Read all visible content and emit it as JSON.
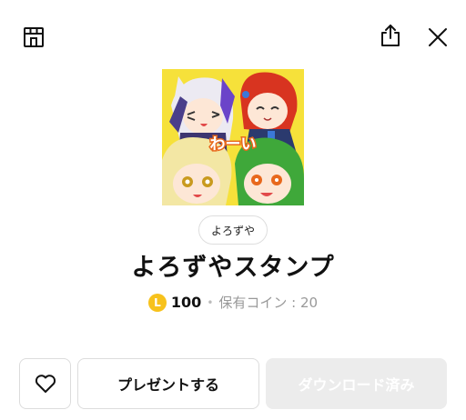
{
  "header": {
    "shop_icon": "shop-icon",
    "share_icon": "share-icon",
    "close_icon": "close-icon"
  },
  "sticker": {
    "thumbnail_text": "わーい",
    "author": "よろずや",
    "title": "よろずやスタンプ",
    "coin_symbol": "L",
    "price": "100",
    "owned_coins": "保有コイン : 20"
  },
  "actions": {
    "favorite_icon": "heart-icon",
    "gift_label": "プレゼントする",
    "download_label": "ダウンロード済み"
  },
  "colors": {
    "coin": "#f7c21c",
    "thumbnail_bg": "#f6e13a",
    "disabled_button": "#ececec"
  }
}
